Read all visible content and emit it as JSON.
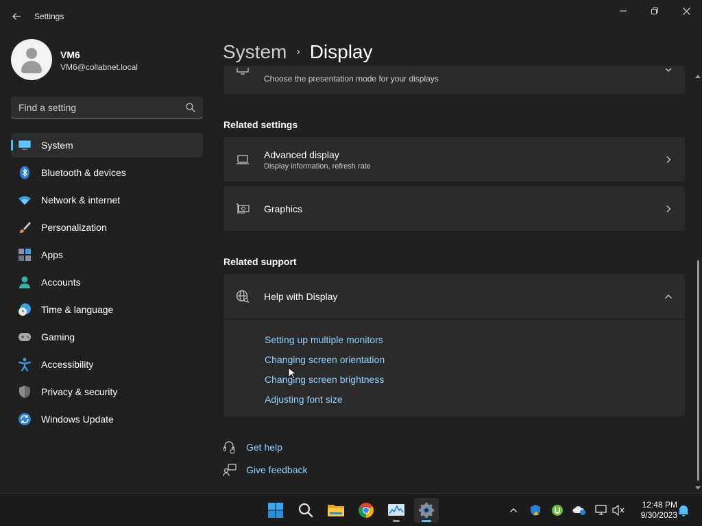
{
  "window": {
    "title": "Settings",
    "controls": {
      "minimize_icon": "minimize-icon",
      "maximize_icon": "restore-icon",
      "close_icon": "close-icon"
    }
  },
  "profile": {
    "name": "VM6",
    "email": "VM6@collabnet.local"
  },
  "search": {
    "placeholder": "Find a setting",
    "value": ""
  },
  "sidebar": {
    "items": [
      {
        "label": "System",
        "icon": "monitor-icon",
        "active": true
      },
      {
        "label": "Bluetooth & devices",
        "icon": "bluetooth-icon"
      },
      {
        "label": "Network & internet",
        "icon": "wifi-icon"
      },
      {
        "label": "Personalization",
        "icon": "brush-icon"
      },
      {
        "label": "Apps",
        "icon": "apps-icon"
      },
      {
        "label": "Accounts",
        "icon": "person-icon"
      },
      {
        "label": "Time & language",
        "icon": "clock-globe-icon"
      },
      {
        "label": "Gaming",
        "icon": "gamepad-icon"
      },
      {
        "label": "Accessibility",
        "icon": "accessibility-icon"
      },
      {
        "label": "Privacy & security",
        "icon": "shield-icon"
      },
      {
        "label": "Windows Update",
        "icon": "update-icon"
      }
    ]
  },
  "breadcrumb": {
    "parent": "System",
    "separator": "›",
    "current": "Display"
  },
  "main": {
    "partial_card": {
      "subtitle": "Choose the presentation mode for your displays"
    },
    "related_settings": {
      "title": "Related settings",
      "items": [
        {
          "title": "Advanced display",
          "subtitle": "Display information, refresh rate",
          "icon": "laptop-icon"
        },
        {
          "title": "Graphics",
          "subtitle": "",
          "icon": "graphics-card-icon"
        }
      ]
    },
    "related_support": {
      "title": "Related support",
      "help": {
        "title": "Help with Display",
        "icon": "globe-search-icon",
        "expanded": true,
        "links": [
          "Setting up multiple monitors",
          "Changing screen orientation",
          "Changing screen brightness",
          "Adjusting font size"
        ]
      }
    },
    "footer": {
      "get_help": "Get help",
      "give_feedback": "Give feedback"
    }
  },
  "taskbar": {
    "apps": [
      "start-icon",
      "search-icon",
      "file-explorer-icon",
      "chrome-icon",
      "task-manager-icon",
      "settings-icon"
    ],
    "tray": [
      "chevron-up-icon",
      "defender-icon",
      "utorrent-icon",
      "onedrive-icon",
      "network-icon",
      "volume-mute-icon",
      "notification-bell-icon"
    ],
    "time": "12:48 PM",
    "date": "9/30/2023"
  },
  "colors": {
    "accent": "#4cc2ff",
    "link": "#8fd3ff",
    "background": "#202020",
    "card": "#2b2b2b"
  }
}
